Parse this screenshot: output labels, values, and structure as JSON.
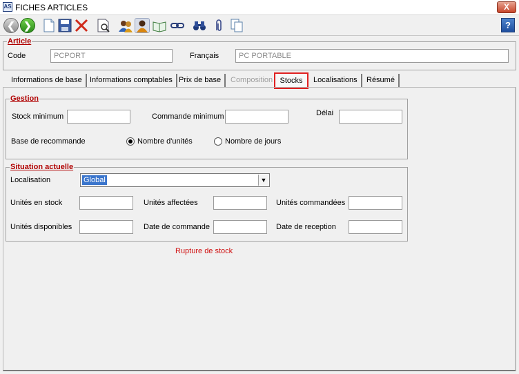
{
  "window": {
    "app_icon": "AS",
    "title": "FICHES ARTICLES",
    "close_label": "X"
  },
  "toolbar": {
    "icons": [
      "back-icon",
      "forward-icon",
      "new-document-icon",
      "save-icon",
      "delete-icon",
      "preview-icon",
      "users-icon",
      "user-icon",
      "book-icon",
      "link-icon",
      "binoculars-icon",
      "attach-icon",
      "copy-icon"
    ],
    "help_label": "?"
  },
  "article": {
    "legend": "Article",
    "code_label": "Code",
    "code_value": "PCPORT",
    "lang_label": "Français",
    "lang_value": "PC PORTABLE"
  },
  "tabs": [
    {
      "label": "Informations de base"
    },
    {
      "label": "Informations comptables"
    },
    {
      "label": "Prix de base"
    },
    {
      "label": "Composition"
    },
    {
      "label": "Stocks"
    },
    {
      "label": "Localisations"
    },
    {
      "label": "Résumé"
    }
  ],
  "gestion": {
    "legend": "Gestion",
    "stock_min_label": "Stock minimum",
    "stock_min_value": "",
    "commande_min_label": "Commande minimum",
    "commande_min_value": "",
    "delai_label": "Délai",
    "delai_value": "",
    "base_label": "Base de recommande",
    "radio_units_label": "Nombre d'unités",
    "radio_days_label": "Nombre de jours",
    "selected": "units"
  },
  "situation": {
    "legend": "Situation actuelle",
    "localisation_label": "Localisation",
    "localisation_value": "Global",
    "unites_stock_label": "Unités en stock",
    "unites_affectees_label": "Unités affectées",
    "unites_commandees_label": "Unités commandées",
    "unites_dispo_label": "Unités disponibles",
    "date_commande_label": "Date de commande",
    "date_reception_label": "Date de reception"
  },
  "status": {
    "rupture": "Rupture de stock"
  },
  "colors": {
    "legend": "#b00000",
    "active_tab_border": "#e02020",
    "selection": "#3a75cc",
    "warning_text": "#d01010"
  }
}
